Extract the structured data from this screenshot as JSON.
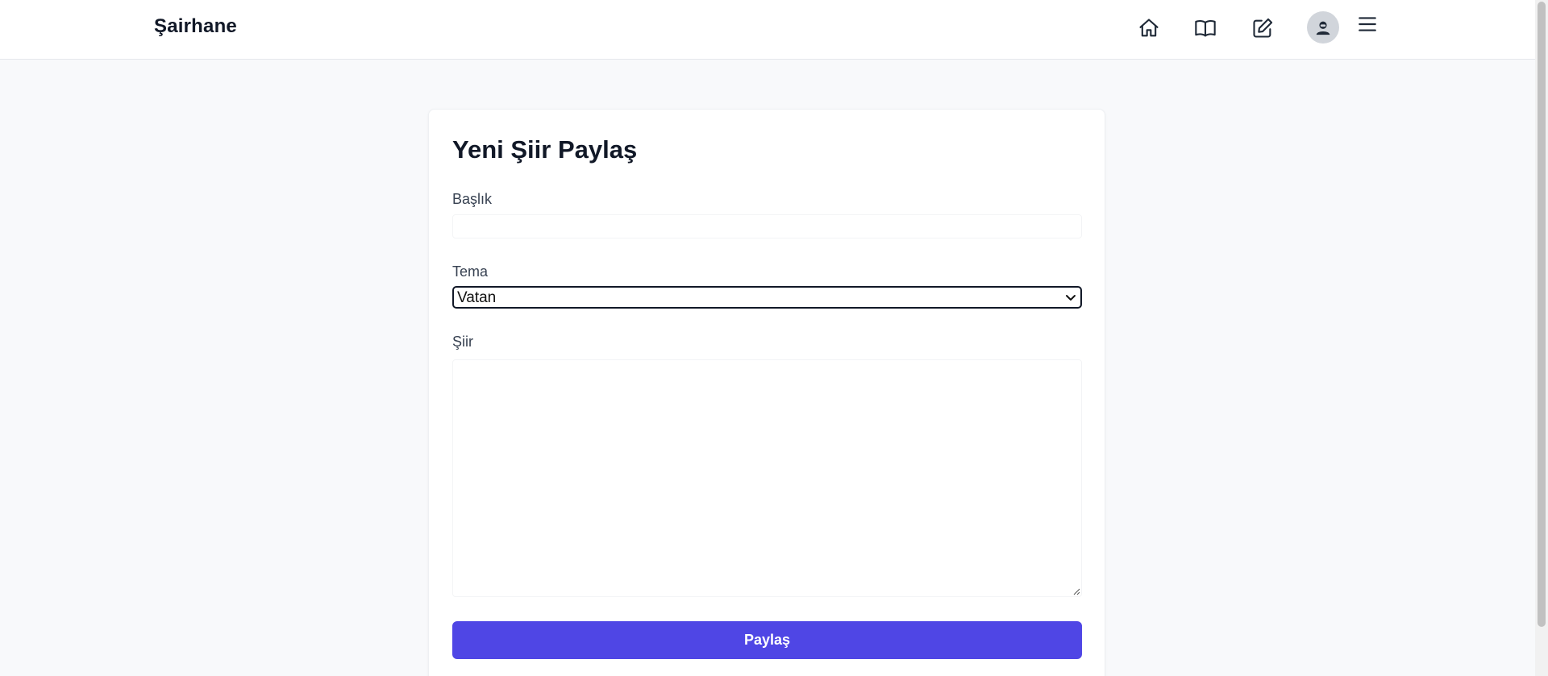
{
  "header": {
    "brand": "Şairhane",
    "nav_icons": [
      "home-icon",
      "book-open-icon",
      "edit-icon",
      "user-avatar-icon",
      "menu-icon"
    ]
  },
  "form": {
    "title": "Yeni Şiir Paylaş",
    "title_label": "Başlık",
    "title_value": "",
    "theme_label": "Tema",
    "theme_value": "Vatan",
    "poem_label": "Şiir",
    "poem_value": "",
    "submit_label": "Paylaş"
  },
  "colors": {
    "accent": "#4f46e5",
    "background": "#f8f9fb",
    "card": "#ffffff",
    "text": "#111827"
  }
}
